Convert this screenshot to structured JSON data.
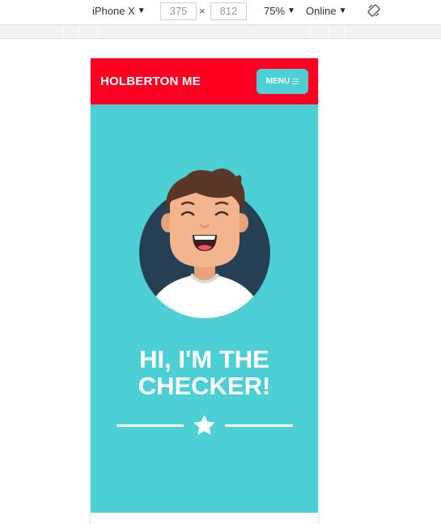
{
  "devtools": {
    "device": "iPhone X",
    "width": "375",
    "height": "812",
    "times": "×",
    "zoom": "75%",
    "network": "Online"
  },
  "site": {
    "brand": "HOLBERTON ME",
    "menu_label": "MENU",
    "headline_line1": "HI, I'M THE",
    "headline_line2": "CHECKER!"
  },
  "colors": {
    "nav_bg": "#ff0022",
    "hero_bg": "#4cd0d6",
    "avatar_circle": "#253f55"
  },
  "icons": [
    "chevron-down-icon",
    "rotate-icon",
    "hamburger-icon",
    "star-icon"
  ]
}
